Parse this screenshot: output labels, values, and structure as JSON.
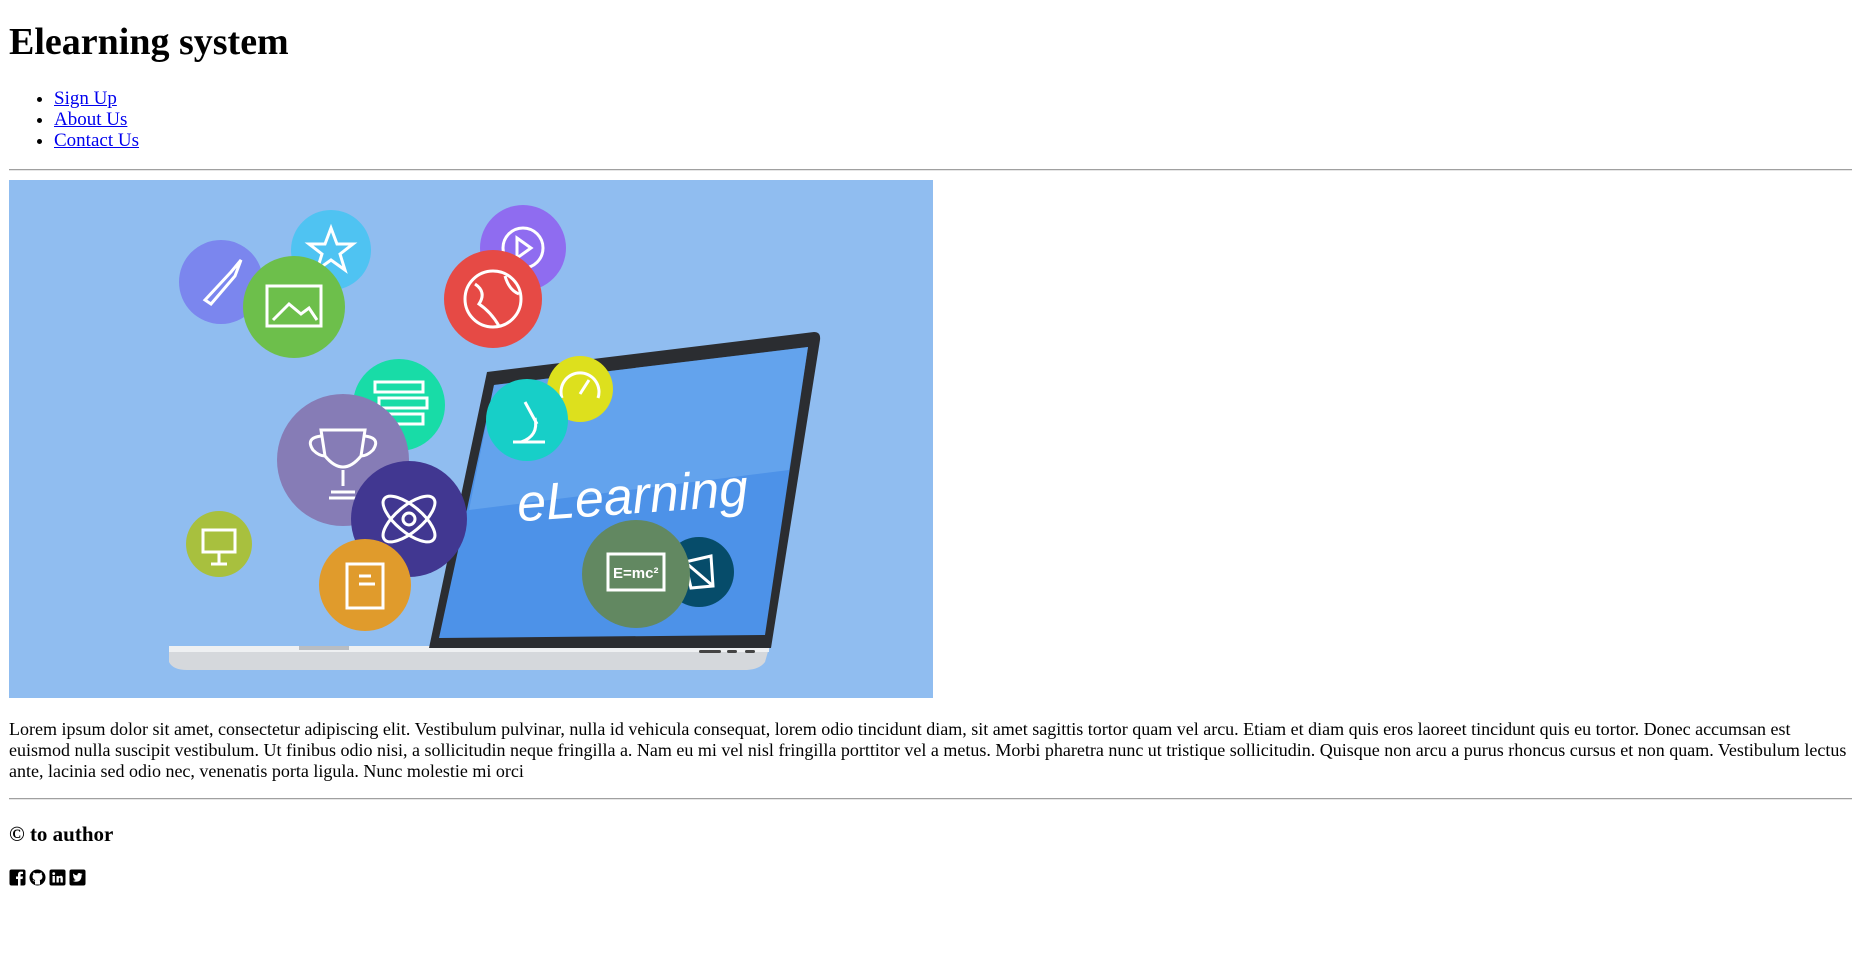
{
  "header": {
    "title": "Elearning system"
  },
  "nav": {
    "items": [
      {
        "label": "Sign Up"
      },
      {
        "label": "About Us"
      },
      {
        "label": "Contact Us"
      }
    ]
  },
  "hero": {
    "laptop_text": "eLearning",
    "formula_text": "E=mc²",
    "background_color": "#90bdf0",
    "icons": [
      "rocket-icon",
      "star-icon",
      "play-icon",
      "image-icon",
      "globe-icon",
      "books-icon",
      "gauge-icon",
      "microscope-icon",
      "trophy-icon",
      "atom-icon",
      "presentation-icon",
      "book-icon",
      "blackboard-icon",
      "network-icon"
    ]
  },
  "main": {
    "paragraph": "Lorem ipsum dolor sit amet, consectetur adipiscing elit. Vestibulum pulvinar, nulla id vehicula consequat, lorem odio tincidunt diam, sit amet sagittis tortor quam vel arcu. Etiam et diam quis eros laoreet tincidunt quis eu tortor. Donec accumsan est euismod nulla suscipit vestibulum. Ut finibus odio nisi, a sollicitudin neque fringilla a. Nam eu mi vel nisl fringilla porttitor vel a metus. Morbi pharetra nunc ut tristique sollicitudin. Quisque non arcu a purus rhoncus cursus et non quam. Vestibulum lectus ante, lacinia sed odio nec, venenatis porta ligula. Nunc molestie mi orci"
  },
  "footer": {
    "copyright": "© to author",
    "social_icons": [
      "facebook-icon",
      "github-icon",
      "linkedin-icon",
      "twitter-icon"
    ]
  }
}
